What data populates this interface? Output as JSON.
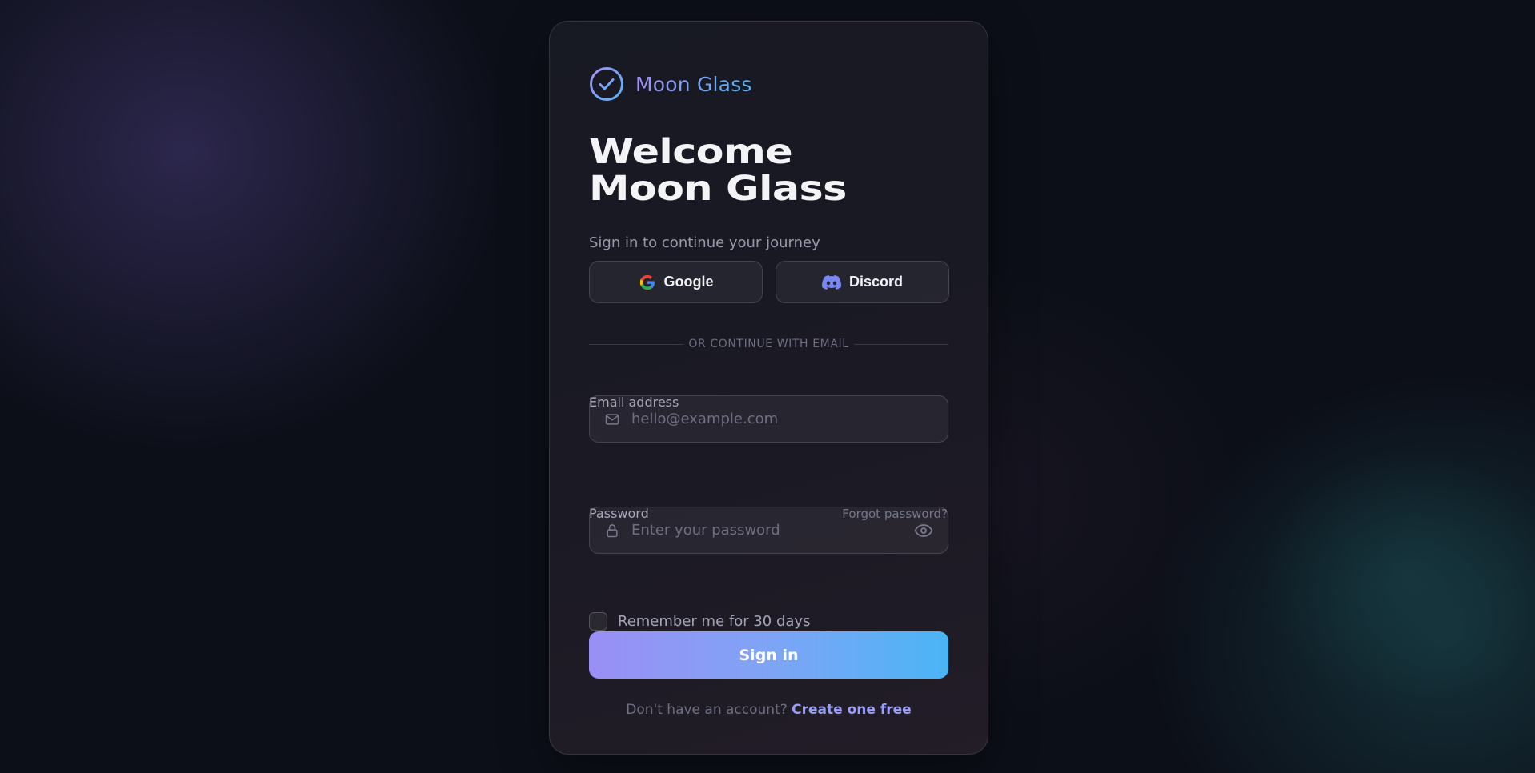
{
  "brand": {
    "name": "Moon Glass",
    "icon": "check-circle-icon"
  },
  "heading": {
    "line1": "Welcome",
    "line2": "Moon Glass"
  },
  "subtitle": "Sign in to continue your journey",
  "social": {
    "google_label": "Google",
    "discord_label": "Discord"
  },
  "divider_text": "OR CONTINUE WITH EMAIL",
  "email": {
    "label": "Email address",
    "placeholder": "hello@example.com",
    "value": "",
    "icon": "mail-icon"
  },
  "password": {
    "label": "Password",
    "forgot_label": "Forgot password?",
    "placeholder": "Enter your password",
    "value": "",
    "icon": "lock-icon",
    "toggle_icon": "eye-icon"
  },
  "remember": {
    "label": "Remember me for 30 days",
    "checked": false
  },
  "signin_label": "Sign in",
  "footer": {
    "prompt": "Don't have an account?",
    "link": "Create one free"
  },
  "colors": {
    "accent_start": "#9a8ff5",
    "accent_end": "#4ab5f5",
    "background": "#0c0f18"
  }
}
